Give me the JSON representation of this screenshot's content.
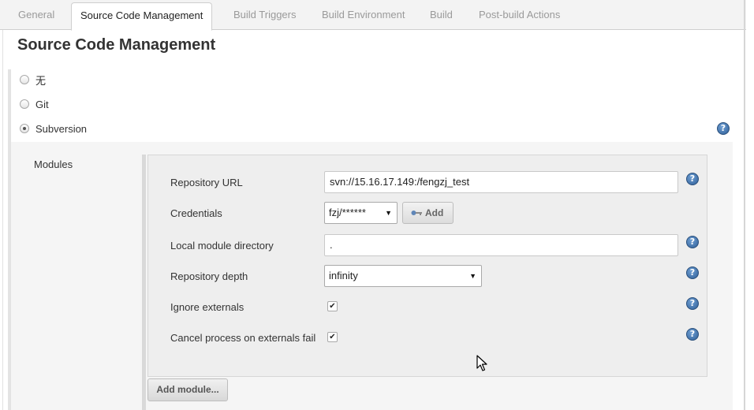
{
  "tabs": [
    {
      "label": "General",
      "active": false
    },
    {
      "label": "Source Code Management",
      "active": true
    },
    {
      "label": "Build Triggers",
      "active": false
    },
    {
      "label": "Build Environment",
      "active": false
    },
    {
      "label": "Build",
      "active": false
    },
    {
      "label": "Post-build Actions",
      "active": false
    }
  ],
  "section": {
    "title": "Source Code Management",
    "options": [
      {
        "label": "无",
        "selected": false
      },
      {
        "label": "Git",
        "selected": false
      },
      {
        "label": "Subversion",
        "selected": true
      }
    ]
  },
  "modules": {
    "label": "Modules",
    "repository_url": {
      "label": "Repository URL",
      "value": "svn://15.16.17.149:/fengzj_test"
    },
    "credentials": {
      "label": "Credentials",
      "value": "fzj/******",
      "add_label": "Add"
    },
    "local_module_directory": {
      "label": "Local module directory",
      "value": "."
    },
    "repository_depth": {
      "label": "Repository depth",
      "value": "infinity"
    },
    "ignore_externals": {
      "label": "Ignore externals",
      "checked": true
    },
    "cancel_process": {
      "label": "Cancel process on externals fail",
      "checked": true
    },
    "add_module_label": "Add module..."
  },
  "icons": {
    "help": "help-icon",
    "key": "key-icon",
    "dropdown": "dropdown-arrow-icon",
    "checkmark": "checkmark-icon",
    "cursor": "mouse-cursor-icon"
  },
  "glyphs": {
    "help": "?",
    "arrow": "▼",
    "check": "✔"
  },
  "colors": {
    "help_icon": "#2f5f98",
    "tab_inactive": "#9a9a9a",
    "panel": "#eeeeee"
  }
}
